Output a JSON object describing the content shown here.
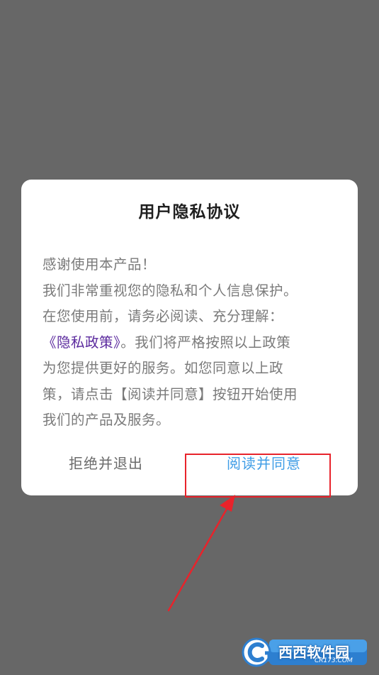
{
  "dialog": {
    "title": "用户隐私协议",
    "body_lines": [
      "感谢使用本产品！",
      "我们非常重视您的隐私和个人信息保护。",
      "在您使用前，请务必阅读、充分理解："
    ],
    "policy_link": "《隐私政策》",
    "policy_line_rest": "。我们将严格按照以上政策",
    "body_lines_after": [
      "为您提供更好的服务。如您同意以上政",
      "策，请点击【阅读并同意】按钮开始使用",
      "我们的产品及服务。"
    ],
    "reject_label": "拒绝并退出",
    "agree_label": "阅读并同意"
  },
  "annotation": {
    "highlight_color": "#e8232b",
    "target": "agree-button"
  },
  "watermark": {
    "brand": "西西软件园",
    "domain": "CR173.COM",
    "logo_letters": "Cr"
  },
  "colors": {
    "backdrop": "#676767",
    "link": "#5b2a9e",
    "agree": "#3f9de6",
    "body_text": "#7a7a7a"
  }
}
